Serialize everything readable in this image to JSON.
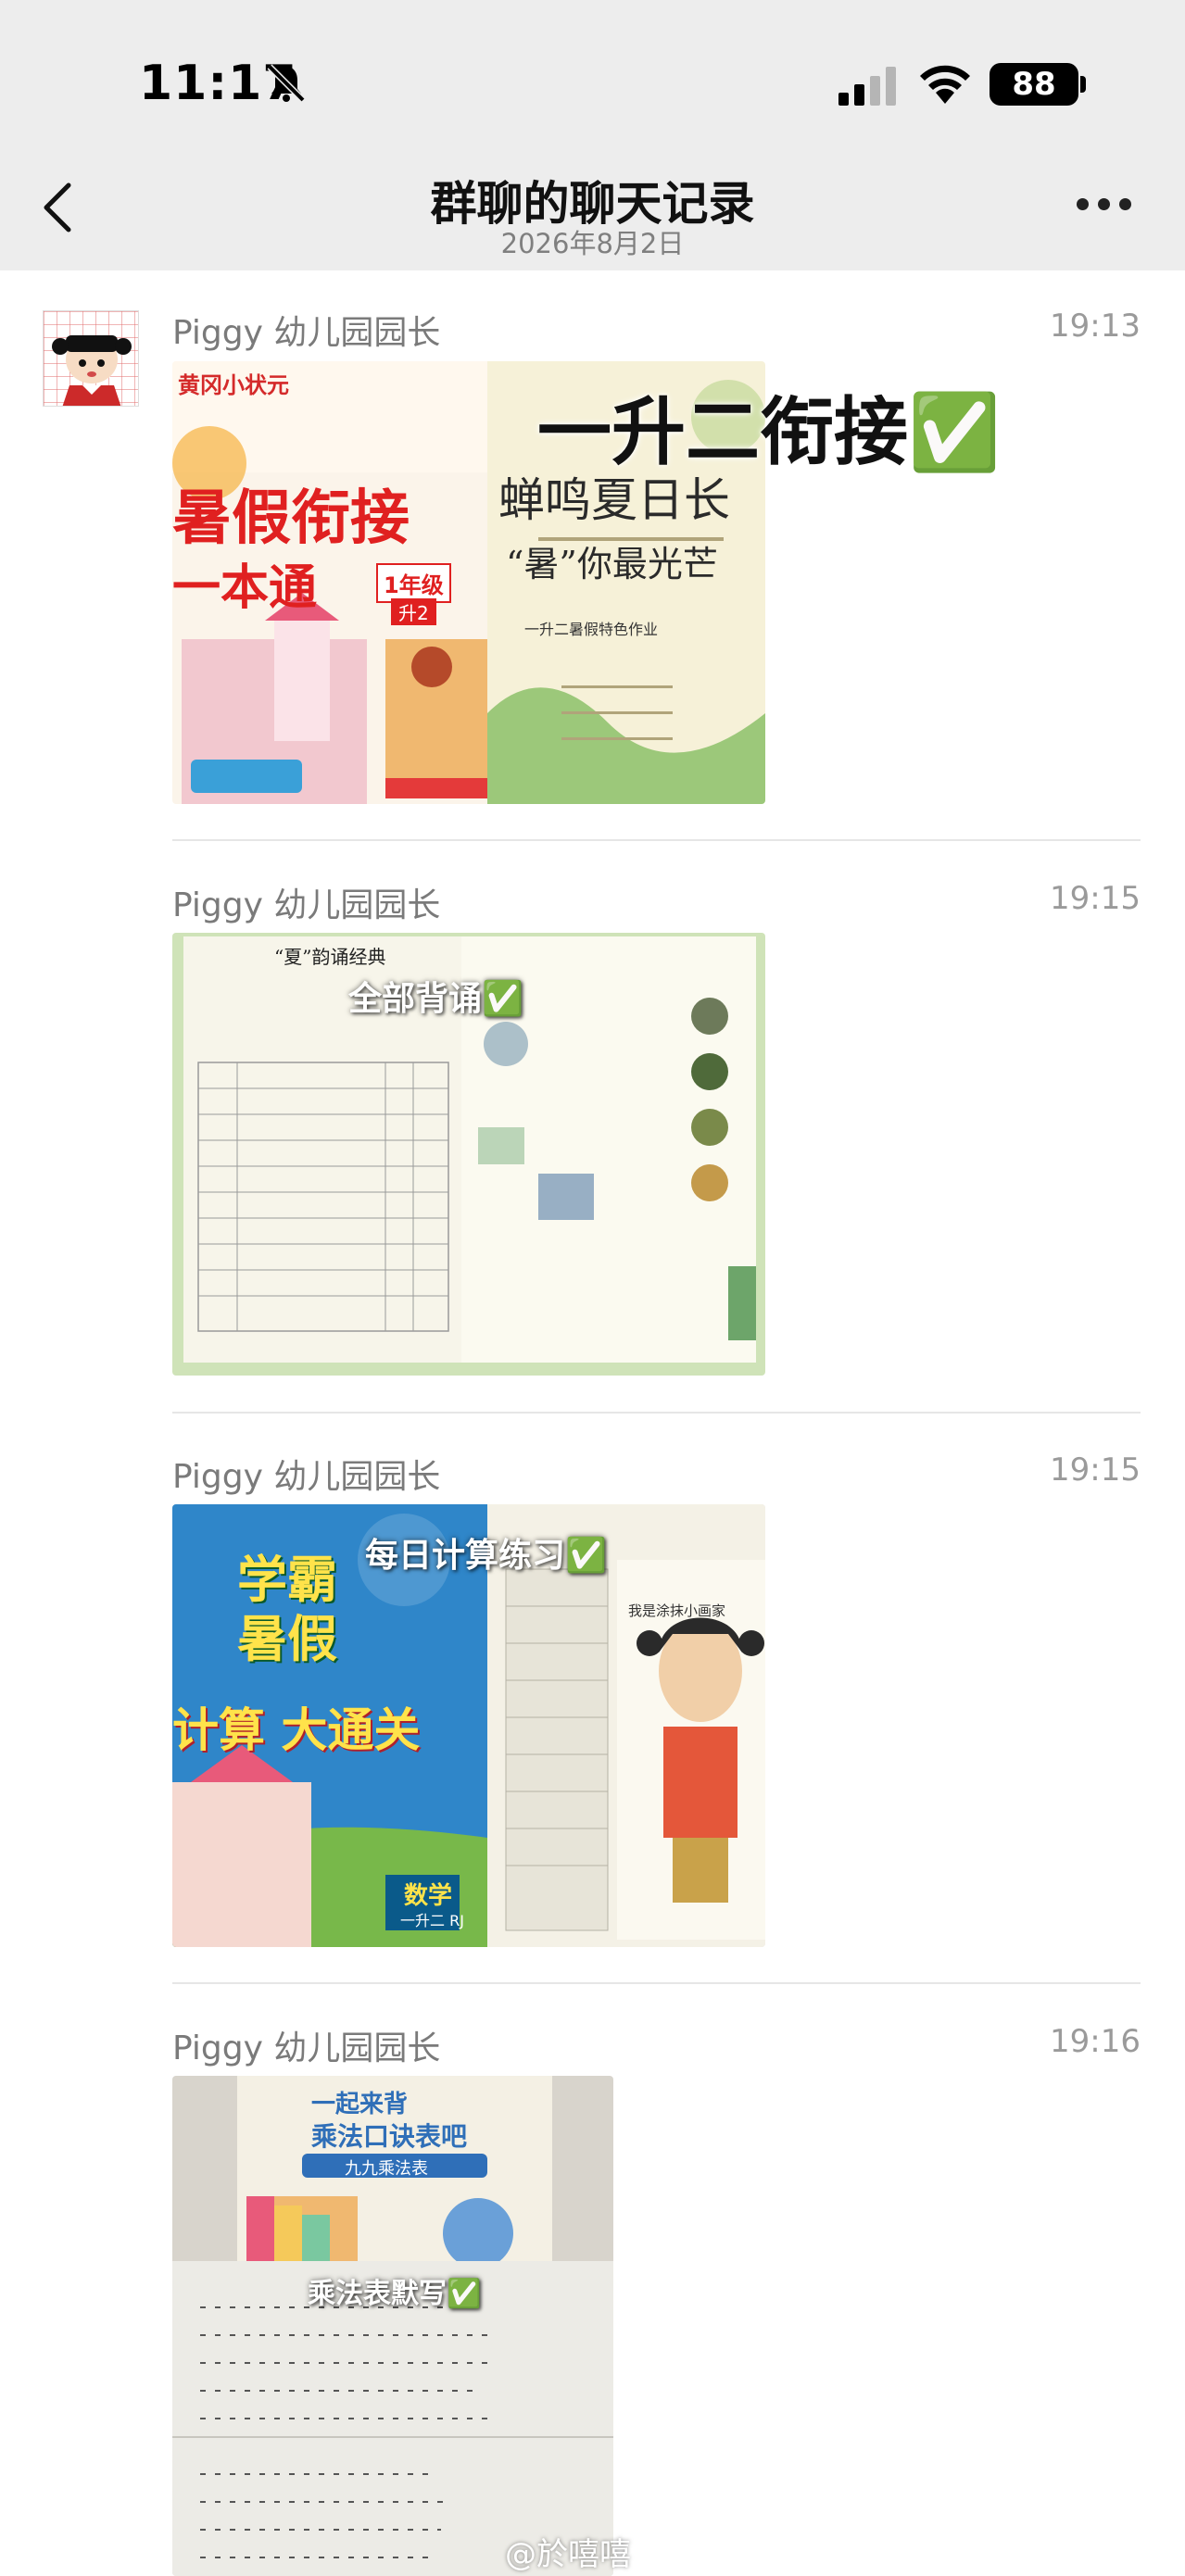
{
  "status_bar": {
    "time": "11:17",
    "battery": "88"
  },
  "header": {
    "title": "群聊的聊天记录",
    "subtitle": "2026年8月2日"
  },
  "messages": [
    {
      "sender": "Piggy 幼儿园园长",
      "time": "19:13",
      "overlay": "一升二衔接✅",
      "book_left_title": "暑假衔接",
      "book_left_sub": "一本通",
      "book_left_brand": "黄冈小状元",
      "book_left_grade": "1年级",
      "book_left_grade2": "升2",
      "book_right_title": "蝉鸣夏日长",
      "book_right_sub": "“暑”你最光芒",
      "book_right_caption": "一升二暑假特色作业"
    },
    {
      "sender": "Piggy 幼儿园园长",
      "time": "19:15",
      "overlay": "全部背诵✅",
      "doc_title": "“夏”韵诵经典"
    },
    {
      "sender": "Piggy 幼儿园园长",
      "time": "19:15",
      "overlay": "每日计算练习✅",
      "book_title": "学霸暑假",
      "book_sub": "计算 大通关",
      "book_subject": "数学",
      "book_grade": "一升二 RJ",
      "right_caption": "我是涂抹小画家"
    },
    {
      "sender": "Piggy 幼儿园园长",
      "time": "19:16",
      "overlay": "乘法表默写✅",
      "poster_title": "一起来背",
      "poster_sub": "乘法口诀表吧",
      "poster_label": "九九乘法表"
    }
  ],
  "watermark": "@於嘻嘻",
  "colors": {
    "bar_bg": "#ededed",
    "name_gray": "#7a7a7a",
    "check_green": "#34b233"
  }
}
